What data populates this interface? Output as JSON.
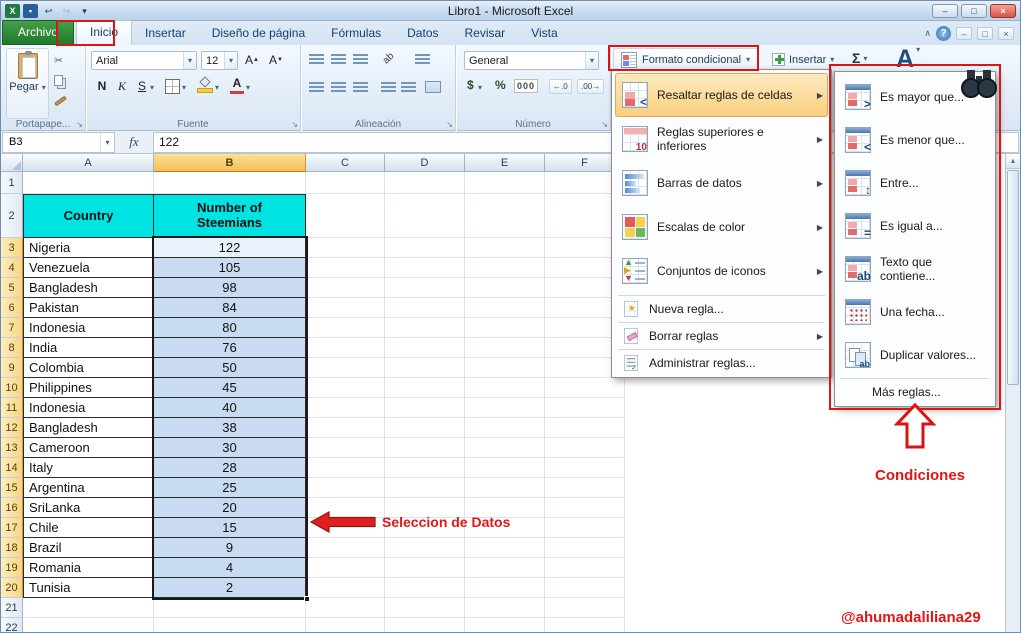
{
  "window": {
    "title": "Libro1 - Microsoft Excel"
  },
  "tabs": [
    {
      "label": "Archivo"
    },
    {
      "label": "Inicio",
      "active": true
    },
    {
      "label": "Insertar"
    },
    {
      "label": "Diseño de página"
    },
    {
      "label": "Fórmulas"
    },
    {
      "label": "Datos"
    },
    {
      "label": "Revisar"
    },
    {
      "label": "Vista"
    }
  ],
  "ribbon": {
    "clipboard": {
      "paste": "Pegar",
      "group": "Portapape..."
    },
    "font": {
      "name": "Arial",
      "size": "12",
      "bold": "N",
      "italic": "K",
      "underline": "S",
      "group": "Fuente"
    },
    "alignment": {
      "group": "Alineación"
    },
    "number": {
      "format": "General",
      "currency": "$",
      "percent": "%",
      "thousands": "000",
      "group": "Número"
    },
    "styles": {
      "conditional": "Formato condicional"
    },
    "cells": {
      "insert": "Insertar"
    },
    "editing": {
      "autosum": "Σ"
    }
  },
  "formula_bar": {
    "name_box": "B3",
    "fx": "fx",
    "value": "122"
  },
  "grid": {
    "columns": [
      "A",
      "B",
      "C",
      "D",
      "E",
      "F"
    ],
    "row_count": 22,
    "selected_column": "B",
    "selected_rows": [
      3,
      20
    ],
    "active_cell": "B3"
  },
  "table": {
    "header": [
      "Country",
      "Number of Steemians"
    ],
    "rows": [
      {
        "country": "Nigeria",
        "value": 122
      },
      {
        "country": "Venezuela",
        "value": 105
      },
      {
        "country": "Bangladesh",
        "value": 98
      },
      {
        "country": "Pakistan",
        "value": 84
      },
      {
        "country": "Indonesia",
        "value": 80
      },
      {
        "country": "India",
        "value": 76
      },
      {
        "country": "Colombia",
        "value": 50
      },
      {
        "country": "Philippines",
        "value": 45
      },
      {
        "country": "Indonesia",
        "value": 40
      },
      {
        "country": "Bangladesh",
        "value": 38
      },
      {
        "country": "Cameroon",
        "value": 30
      },
      {
        "country": "Italy",
        "value": 28
      },
      {
        "country": "Argentina",
        "value": 25
      },
      {
        "country": "SriLanka",
        "value": 20
      },
      {
        "country": "Chile",
        "value": 15
      },
      {
        "country": "Brazil",
        "value": 9
      },
      {
        "country": "Romania",
        "value": 4
      },
      {
        "country": "Tunisia",
        "value": 2
      }
    ]
  },
  "menu": {
    "items": [
      {
        "label": "Resaltar reglas de celdas",
        "icon": "highlight-cells-rules-icon",
        "submenu": true,
        "highlighted": true
      },
      {
        "label": "Reglas superiores e inferiores",
        "icon": "top-bottom-rules-icon",
        "submenu": true
      },
      {
        "label": "Barras de datos",
        "icon": "data-bars-icon",
        "submenu": true
      },
      {
        "label": "Escalas de color",
        "icon": "color-scales-icon",
        "submenu": true
      },
      {
        "label": "Conjuntos de iconos",
        "icon": "icon-sets-icon",
        "submenu": true
      }
    ],
    "footer_items": [
      {
        "label": "Nueva regla...",
        "icon": "new-rule-icon"
      },
      {
        "label": "Borrar reglas",
        "icon": "clear-rules-icon",
        "submenu": true
      },
      {
        "label": "Administrar reglas...",
        "icon": "manage-rules-icon"
      }
    ]
  },
  "submenu": {
    "items": [
      {
        "label": "Es mayor que...",
        "icon": "greater-than-icon"
      },
      {
        "label": "Es menor que...",
        "icon": "less-than-icon"
      },
      {
        "label": "Entre...",
        "icon": "between-icon"
      },
      {
        "label": "Es igual a...",
        "icon": "equal-to-icon"
      },
      {
        "label": "Texto que contiene...",
        "icon": "text-contains-icon"
      },
      {
        "label": "Una fecha...",
        "icon": "date-occurring-icon"
      },
      {
        "label": "Duplicar valores...",
        "icon": "duplicate-values-icon"
      }
    ],
    "more": {
      "label": "Más reglas..."
    }
  },
  "annotations": {
    "data_selection": "Seleccion de Datos",
    "conditions": "Condiciones",
    "credit": "@ahumadaliliana29",
    "highlight_color": "#dd1111"
  }
}
